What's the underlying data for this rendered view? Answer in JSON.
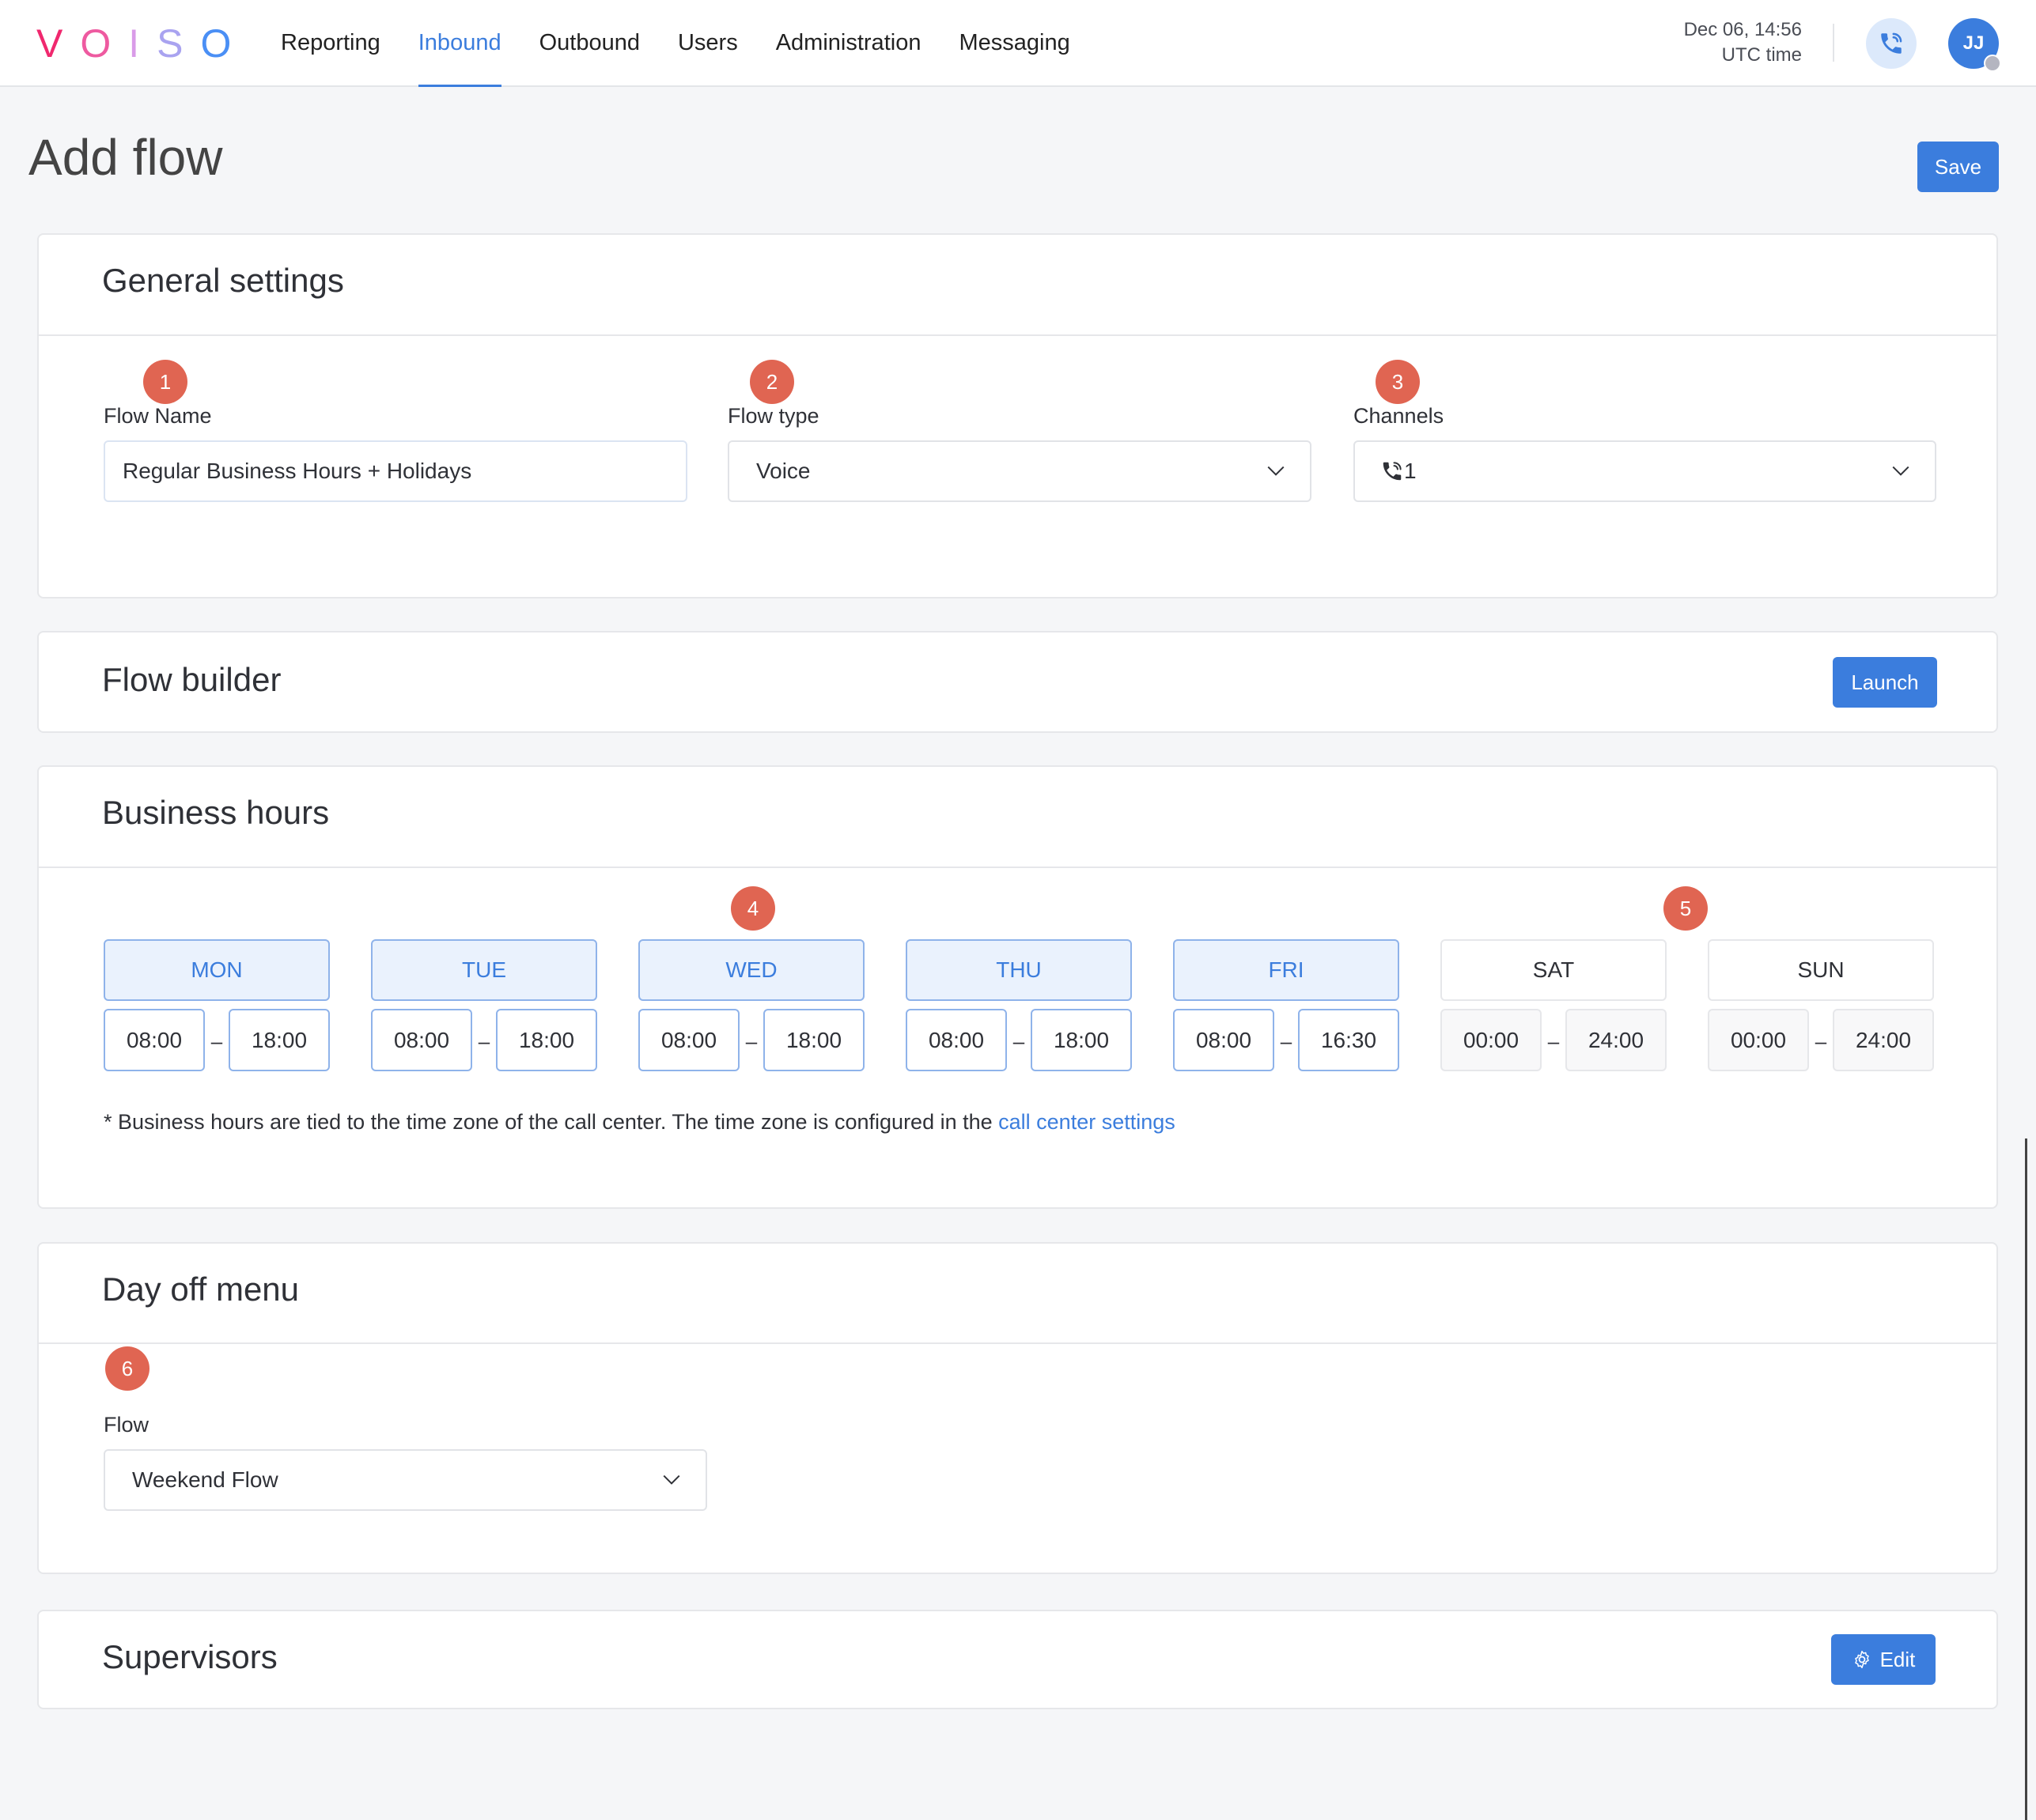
{
  "brand": {
    "letters": [
      "V",
      "O",
      "I",
      "S",
      "O"
    ],
    "colors": [
      "#f0286e",
      "#ee5aa0",
      "#d99be8",
      "#a9a3f0",
      "#4a8ff5"
    ]
  },
  "nav": {
    "items": [
      {
        "label": "Reporting",
        "active": false
      },
      {
        "label": "Inbound",
        "active": true
      },
      {
        "label": "Outbound",
        "active": false
      },
      {
        "label": "Users",
        "active": false
      },
      {
        "label": "Administration",
        "active": false
      },
      {
        "label": "Messaging",
        "active": false
      }
    ]
  },
  "clock": {
    "datetime": "Dec 06, 14:56",
    "timezone": "UTC time"
  },
  "user": {
    "initials": "JJ"
  },
  "page": {
    "title": "Add flow",
    "save_label": "Save"
  },
  "general": {
    "title": "General settings",
    "flow_name": {
      "badge": "1",
      "label": "Flow Name",
      "value": "Regular Business Hours + Holidays"
    },
    "flow_type": {
      "badge": "2",
      "label": "Flow type",
      "value": "Voice"
    },
    "channels": {
      "badge": "3",
      "label": "Channels",
      "value": "1"
    }
  },
  "flow_builder": {
    "title": "Flow builder",
    "launch_label": "Launch"
  },
  "business_hours": {
    "title": "Business hours",
    "badges": [
      "4",
      "5"
    ],
    "days": [
      {
        "label": "MON",
        "enabled": true,
        "start": "08:00",
        "end": "18:00"
      },
      {
        "label": "TUE",
        "enabled": true,
        "start": "08:00",
        "end": "18:00"
      },
      {
        "label": "WED",
        "enabled": true,
        "start": "08:00",
        "end": "18:00"
      },
      {
        "label": "THU",
        "enabled": true,
        "start": "08:00",
        "end": "18:00"
      },
      {
        "label": "FRI",
        "enabled": true,
        "start": "08:00",
        "end": "16:30"
      },
      {
        "label": "SAT",
        "enabled": false,
        "start": "00:00",
        "end": "24:00"
      },
      {
        "label": "SUN",
        "enabled": false,
        "start": "00:00",
        "end": "24:00"
      }
    ],
    "separator": "–",
    "note": "* Business hours are tied to the time zone of the call center. The time zone is configured in the ",
    "note_link": "call center settings"
  },
  "day_off": {
    "title": "Day off menu",
    "badge": "6",
    "label": "Flow",
    "value": "Weekend Flow"
  },
  "supervisors": {
    "title": "Supervisors",
    "edit_label": "Edit"
  },
  "colors": {
    "accent": "#3b7ddd",
    "badge": "#e06552",
    "background": "#f5f6f8"
  }
}
